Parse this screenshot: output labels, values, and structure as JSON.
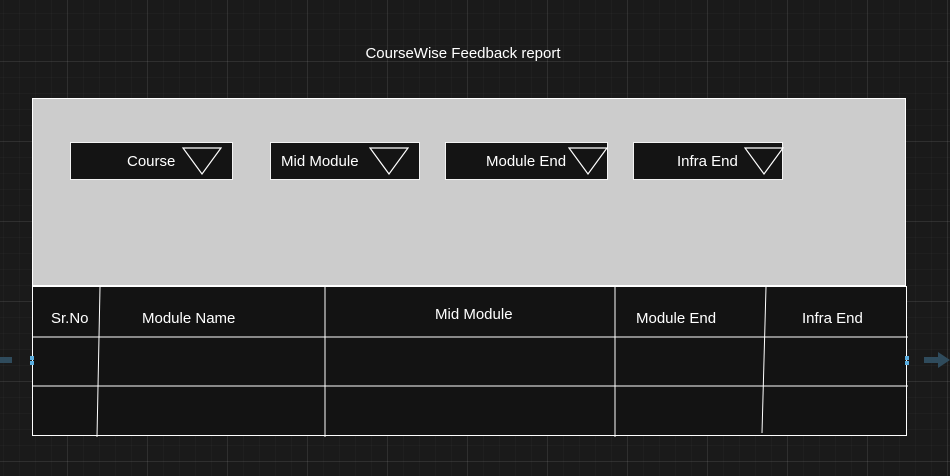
{
  "page": {
    "title": "CourseWise Feedback report"
  },
  "filters": {
    "course_label": "Course",
    "mid_module_label": "Mid Module",
    "module_end_label": "Module End",
    "infra_end_label": "Infra End"
  },
  "table": {
    "headers": {
      "sr_no": "Sr.No",
      "module_name": "Module Name",
      "mid_module": "Mid Module",
      "module_end": "Module End",
      "infra_end": "Infra End"
    },
    "rows": [
      [
        "",
        "",
        "",
        "",
        ""
      ],
      [
        "",
        "",
        "",
        "",
        ""
      ]
    ]
  },
  "icons": {
    "dropdown_arrow": "triangle-down-icon"
  },
  "colors": {
    "canvas_background": "#1a1a1a",
    "panel_background": "#cccccc",
    "control_background": "#141414",
    "line": "#ffffff",
    "handle": "#5aaee0"
  }
}
